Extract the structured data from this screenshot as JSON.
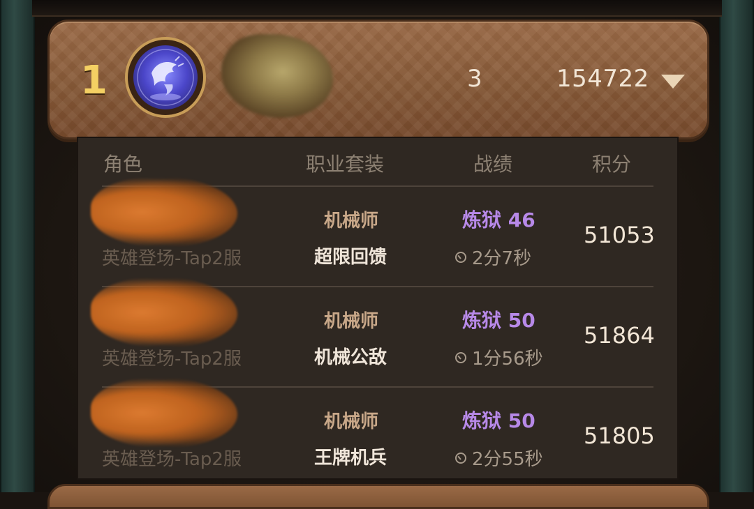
{
  "team": {
    "rank": "1",
    "member_count": "3",
    "total_score": "154722"
  },
  "columns": {
    "role": "角色",
    "class_suit": "职业套装",
    "record": "战绩",
    "score": "积分"
  },
  "members": [
    {
      "server": "英雄登场-Tap2服",
      "class": "机械师",
      "suit": "超限回馈",
      "stage": "炼狱 46",
      "time": "2分7秒",
      "score": "51053"
    },
    {
      "server": "英雄登场-Tap2服",
      "class": "机械师",
      "suit": "机械公敌",
      "stage": "炼狱 50",
      "time": "1分56秒",
      "score": "51864"
    },
    {
      "server": "英雄登场-Tap2服",
      "class": "机械师",
      "suit": "王牌机兵",
      "stage": "炼狱 50",
      "time": "2分55秒",
      "score": "51805"
    }
  ],
  "colors": {
    "rank_gold": "#f4d063",
    "stage_purple": "#b789e8",
    "header_brown": "#865937",
    "panel_bg": "#2f2822"
  },
  "icons": {
    "avatar": "dragon-emblem-icon",
    "dropdown": "triangle-down-icon",
    "time": "clock-icon"
  }
}
